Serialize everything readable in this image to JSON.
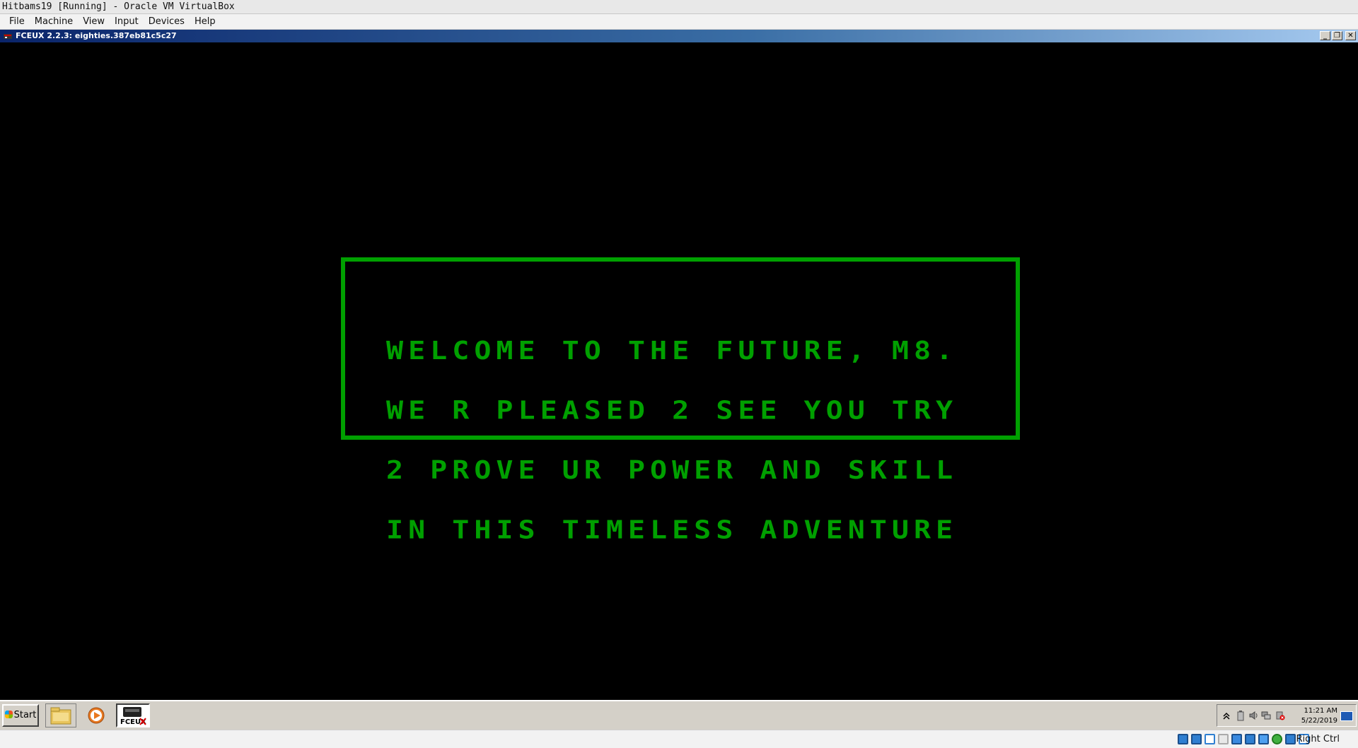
{
  "host": {
    "window_title": "Hitbams19 [Running] - Oracle VM VirtualBox",
    "menu": [
      "File",
      "Machine",
      "View",
      "Input",
      "Devices",
      "Help"
    ],
    "host_key_label": "Right Ctrl",
    "status_icons": [
      "hard-disk-icon",
      "optical-drive-icon",
      "audio-icon",
      "network-icon",
      "usb-icon",
      "shared-folders-icon",
      "display-icon",
      "video-capture-icon",
      "virtualization-icon",
      "mouse-integration-icon",
      "keyboard-icon"
    ]
  },
  "guest": {
    "window_title": "FCEUX 2.2.3: eighties.387eb81c5c27",
    "window_buttons": {
      "minimize": "_",
      "restore": "❐",
      "close": "✕"
    },
    "game_message": [
      "WELCOME TO THE FUTURE, M8.",
      "WE R PLEASED 2 SEE YOU TRY",
      "2 PROVE UR POWER AND SKILL",
      "IN THIS TIMELESS ADVENTURE"
    ],
    "colors": {
      "game_text": "#00a000",
      "game_border": "#00a000",
      "game_background": "#000000"
    },
    "taskbar": {
      "start_label": "Start",
      "quick_launch": [
        "explorer-icon",
        "media-player-icon"
      ],
      "task_button": "fceux-icon",
      "task_button_text": "FCEUX",
      "tray_icons": [
        "show-hidden-icon",
        "battery-icon",
        "volume-icon",
        "network-icon",
        "safely-remove-icon"
      ],
      "clock_time": "11:21 AM",
      "clock_date": "5/22/2019"
    }
  }
}
